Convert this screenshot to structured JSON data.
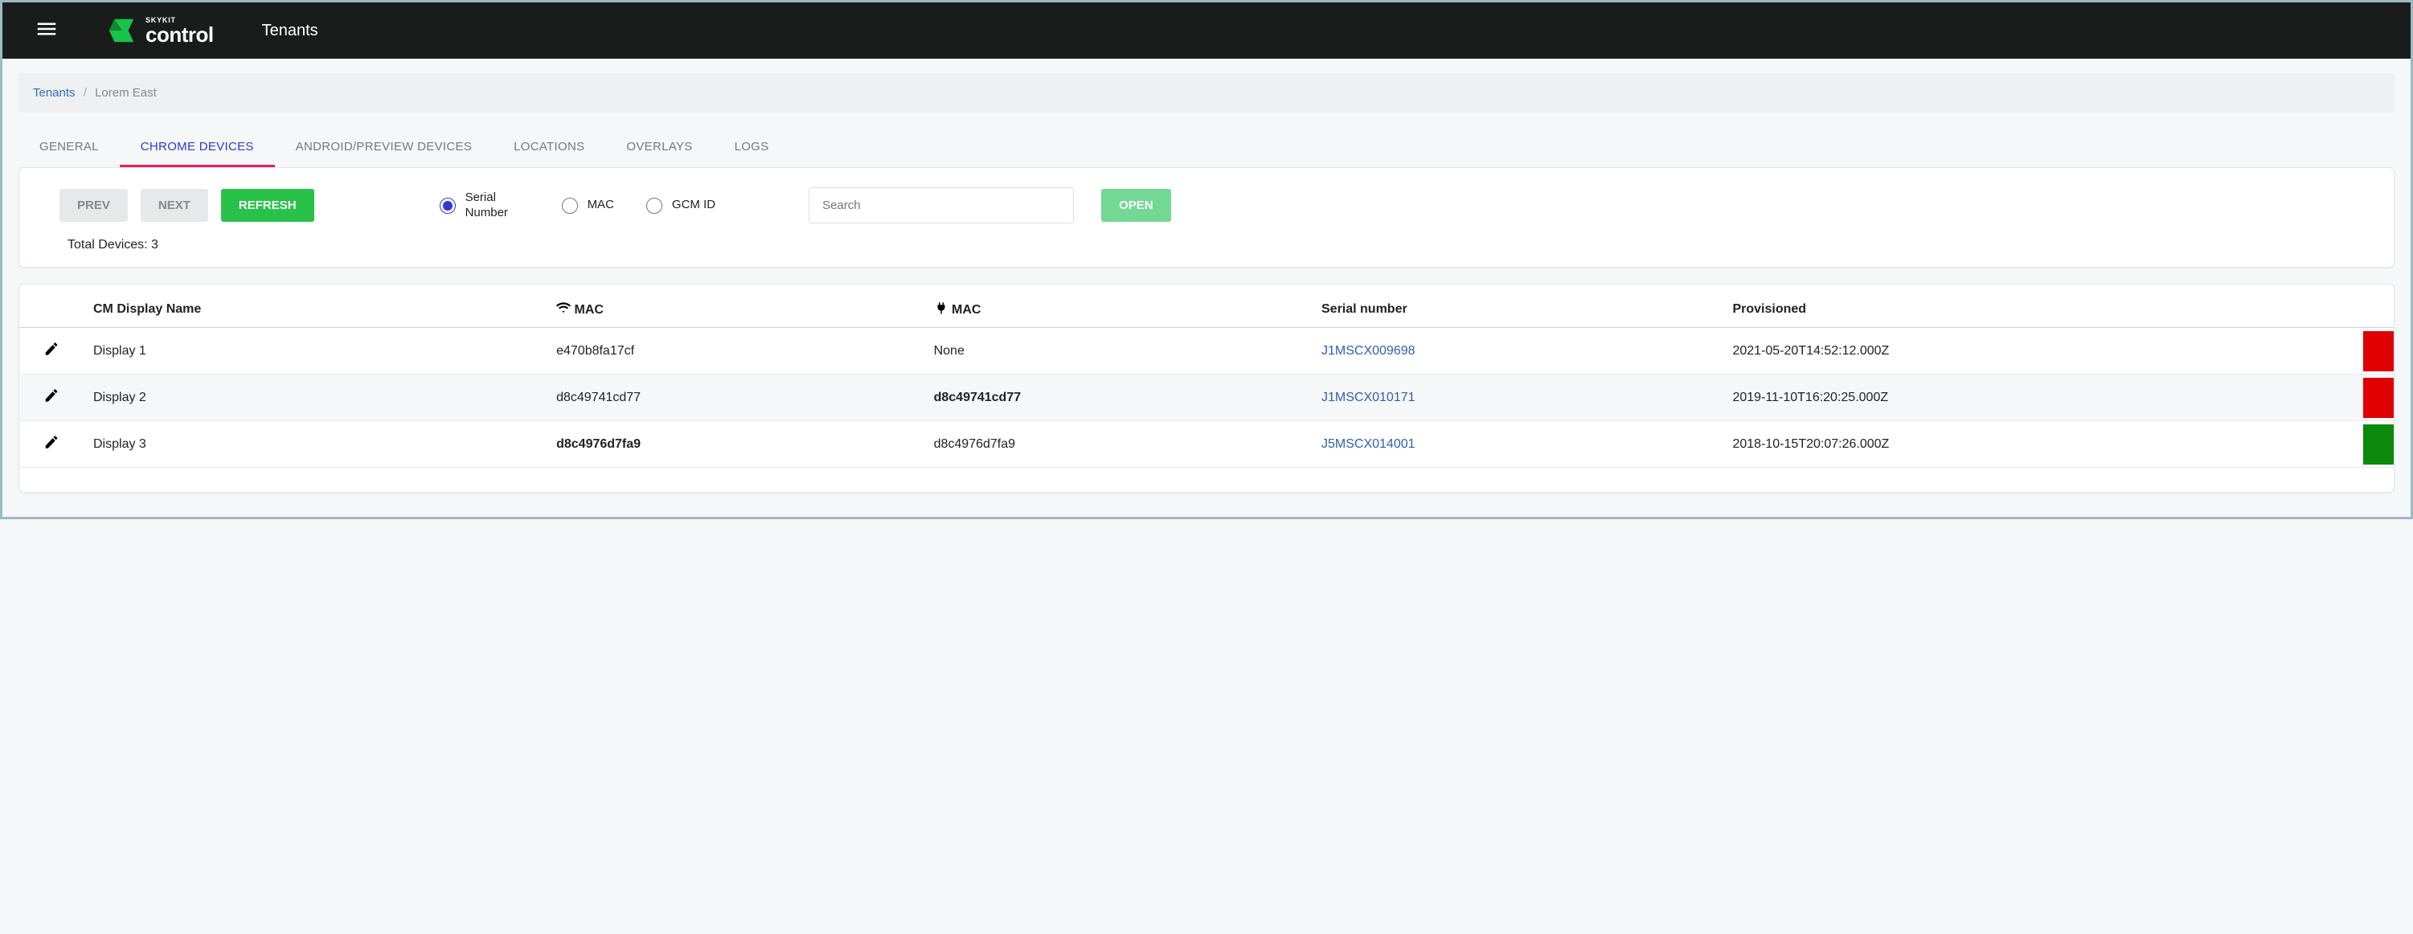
{
  "header": {
    "brand_small": "SKYKIT",
    "brand_big": "control",
    "page_title": "Tenants"
  },
  "breadcrumb": {
    "root": "Tenants",
    "current": "Lorem East"
  },
  "tabs": {
    "general": "GENERAL",
    "chrome": "CHROME DEVICES",
    "android": "ANDROID/PREVIEW DEVICES",
    "locations": "LOCATIONS",
    "overlays": "OVERLAYS",
    "logs": "LOGS"
  },
  "controls": {
    "prev": "PREV",
    "next": "NEXT",
    "refresh": "REFRESH",
    "open": "OPEN",
    "search_placeholder": "Search",
    "total_label": "Total Devices: 3",
    "radio_serial": "Serial Number",
    "radio_mac": "MAC",
    "radio_gcm": "GCM ID"
  },
  "table": {
    "headers": {
      "name": "CM Display Name",
      "wifi_mac": "MAC",
      "eth_mac": "MAC",
      "serial": "Serial number",
      "provisioned": "Provisioned"
    },
    "rows": [
      {
        "name": "Display 1",
        "wifi_mac": "e470b8fa17cf",
        "wifi_bold": false,
        "eth_mac": "None",
        "eth_bold": false,
        "serial": "J1MSCX009698",
        "provisioned": "2021-05-20T14:52:12.000Z",
        "status": "red"
      },
      {
        "name": "Display 2",
        "wifi_mac": "d8c49741cd77",
        "wifi_bold": false,
        "eth_mac": "d8c49741cd77",
        "eth_bold": true,
        "serial": "J1MSCX010171",
        "provisioned": "2019-11-10T16:20:25.000Z",
        "status": "red"
      },
      {
        "name": "Display 3",
        "wifi_mac": "d8c4976d7fa9",
        "wifi_bold": true,
        "eth_mac": "d8c4976d7fa9",
        "eth_bold": false,
        "serial": "J5MSCX014001",
        "provisioned": "2018-10-15T20:07:26.000Z",
        "status": "green"
      }
    ]
  }
}
